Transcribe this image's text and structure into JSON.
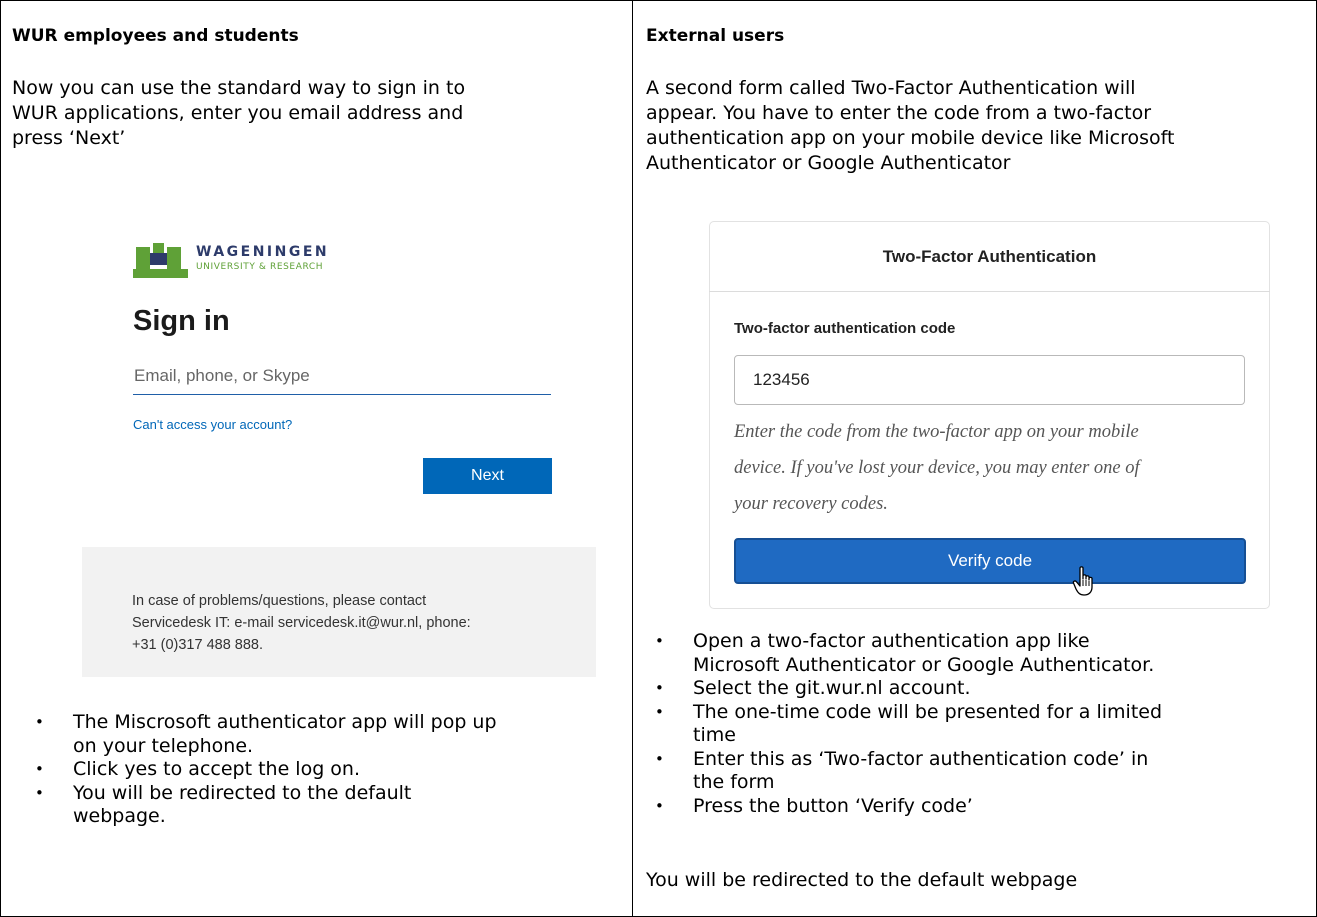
{
  "left": {
    "heading": "WUR employees and students",
    "intro_line1": "Now you can use the standard way to sign in to",
    "intro_line2": "WUR applications, enter you email address and",
    "intro_line3": "press ‘Next’",
    "signin": {
      "brand_line1": "WAGENINGEN",
      "brand_line2": "UNIVERSITY & RESEARCH",
      "title": "Sign in",
      "email_placeholder": "Email, phone, or Skype",
      "cant_access": "Can't access your account?",
      "next_label": "Next",
      "help_line1": "In case of problems/questions, please contact",
      "help_line2": "Servicedesk IT: e-mail servicedesk.it@wur.nl, phone:",
      "help_line3": "+31 (0)317 488 888."
    },
    "bullets": [
      {
        "line1": "The Miscrosoft authenticator app will pop up",
        "line2": "on your telephone."
      },
      {
        "line1": "Click yes to accept the log on.",
        "line2": ""
      },
      {
        "line1": "You will be redirected to the default",
        "line2": "webpage."
      }
    ],
    "bullet_symbol": "•"
  },
  "right": {
    "heading": "External users",
    "intro_line1": "A second form called Two-Factor Authentication will",
    "intro_line2": "appear. You have to enter the code from a two-factor",
    "intro_line3": "authentication app on your mobile device like Microsoft",
    "intro_line4": "Authenticator or Google Authenticator",
    "tfa": {
      "title": "Two-Factor Authentication",
      "code_label": "Two-factor authentication code",
      "code_value": "123456",
      "help_line1": "Enter the code from the two-factor app on your mobile",
      "help_line2": "device. If you've lost your device, you may enter one of",
      "help_line3": "your recovery codes.",
      "verify_label": "Verify code"
    },
    "bullets": [
      {
        "line1": "Open a two-factor authentication app like",
        "line2": "Microsoft Authenticator or Google Authenticator."
      },
      {
        "line1": "Select the git.wur.nl account.",
        "line2": ""
      },
      {
        "line1": "The one-time code will be presented for a limited",
        "line2": "time"
      },
      {
        "line1": "Enter this as ‘Two-factor authentication code’ in",
        "line2": "the form"
      },
      {
        "line1": "Press the button ‘Verify code’",
        "line2": ""
      }
    ],
    "final_line": "You will be redirected to the default webpage",
    "bullet_symbol": "•"
  },
  "colors": {
    "ms_blue": "#0067b8",
    "verify_blue": "#1f6ac2",
    "wur_green": "#5fa137",
    "wur_navy": "#2d3b6a"
  }
}
